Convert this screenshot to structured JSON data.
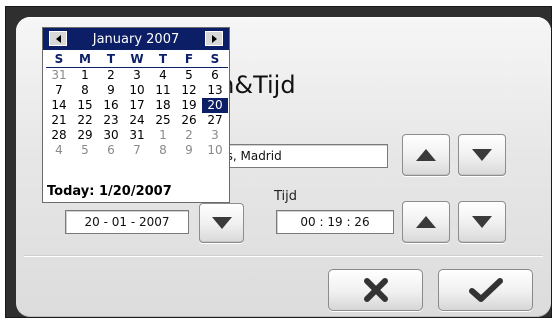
{
  "dialog": {
    "title": "m&Tijd",
    "timezone_value": "rijs, Madrid",
    "date_value": "20 - 01 - 2007",
    "time_label": "Tijd",
    "time_value": "00 : 19 : 26"
  },
  "calendar": {
    "month_label": "January 2007",
    "weekdays": [
      "S",
      "M",
      "T",
      "W",
      "T",
      "F",
      "S"
    ],
    "weeks": [
      [
        {
          "d": "31",
          "o": true
        },
        {
          "d": "1"
        },
        {
          "d": "2"
        },
        {
          "d": "3"
        },
        {
          "d": "4"
        },
        {
          "d": "5"
        },
        {
          "d": "6"
        }
      ],
      [
        {
          "d": "7"
        },
        {
          "d": "8"
        },
        {
          "d": "9"
        },
        {
          "d": "10"
        },
        {
          "d": "11"
        },
        {
          "d": "12"
        },
        {
          "d": "13"
        }
      ],
      [
        {
          "d": "14"
        },
        {
          "d": "15"
        },
        {
          "d": "16"
        },
        {
          "d": "17"
        },
        {
          "d": "18"
        },
        {
          "d": "19"
        },
        {
          "d": "20",
          "sel": true
        }
      ],
      [
        {
          "d": "21"
        },
        {
          "d": "22"
        },
        {
          "d": "23"
        },
        {
          "d": "24"
        },
        {
          "d": "25"
        },
        {
          "d": "26"
        },
        {
          "d": "27"
        }
      ],
      [
        {
          "d": "28"
        },
        {
          "d": "29"
        },
        {
          "d": "30"
        },
        {
          "d": "31"
        },
        {
          "d": "1",
          "o": true
        },
        {
          "d": "2",
          "o": true
        },
        {
          "d": "3",
          "o": true
        }
      ],
      [
        {
          "d": "4",
          "o": true
        },
        {
          "d": "5",
          "o": true
        },
        {
          "d": "6",
          "o": true
        },
        {
          "d": "7",
          "o": true
        },
        {
          "d": "8",
          "o": true
        },
        {
          "d": "9",
          "o": true
        },
        {
          "d": "10",
          "o": true
        }
      ]
    ],
    "today_text": "Today: 1/20/2007"
  },
  "icons": {
    "prev": "triangle-left-icon",
    "next": "triangle-right-icon",
    "up": "arrow-up-icon",
    "down": "arrow-down-icon",
    "cancel": "x-icon",
    "ok": "checkmark-icon"
  },
  "colors": {
    "calendar_header": "#0b1e66",
    "frame": "#2f2f2f"
  }
}
